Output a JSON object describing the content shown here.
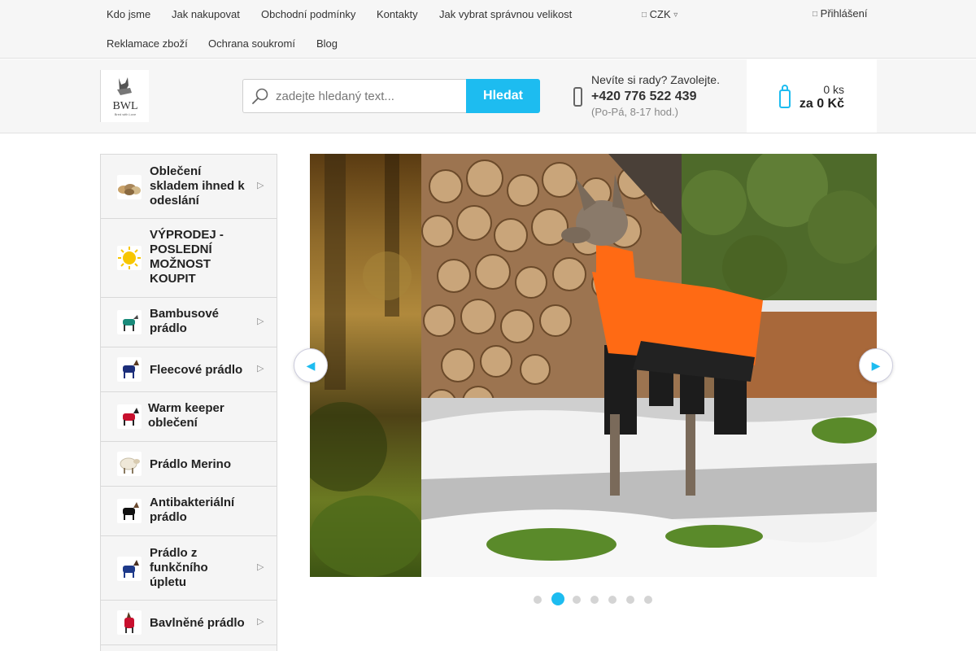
{
  "topnav": {
    "links": [
      "Kdo jsme",
      "Jak nakupovat",
      "Obchodní podmínky",
      "Kontakty",
      "Jak vybrat správnou velikost",
      "Reklamace zboží",
      "Ochrana soukromí",
      "Blog"
    ],
    "currency": "CZK",
    "login": "Přihlášení"
  },
  "header": {
    "logo_text": "BWL",
    "logo_sub": "Bred with Love",
    "search": {
      "placeholder": "zadejte hledaný text...",
      "button": "Hledat"
    },
    "contact": {
      "question": "Nevíte si rady? Zavolejte.",
      "phone": "+420 776 522 439",
      "hours": "(Po-Pá, 8-17 hod.)"
    },
    "cart": {
      "count": "0 ks",
      "total": "za 0 Kč"
    }
  },
  "sidebar": {
    "categories": [
      {
        "lines": [
          "Oblečení",
          "skladem ihned k",
          "odeslání"
        ],
        "has_submenu": true,
        "thumb": "clothes-pile"
      },
      {
        "lines": [
          "VÝPRODEJ -",
          "POSLEDNÍ",
          "MOŽNOST",
          "KOUPIT"
        ],
        "has_submenu": false,
        "thumb": "sun"
      },
      {
        "lines": [
          "Bambusové",
          "prádlo"
        ],
        "has_submenu": true,
        "thumb": "dog-green"
      },
      {
        "lines": [
          "Fleecové prádlo"
        ],
        "has_submenu": true,
        "thumb": "dog-navy"
      },
      {
        "lines": [
          "Warm keeper",
          "oblečení"
        ],
        "has_submenu": false,
        "thumb": "dog-red"
      },
      {
        "lines": [
          "Prádlo Merino"
        ],
        "has_submenu": false,
        "thumb": "sheep"
      },
      {
        "lines": [
          "Antibakteriální",
          "prádlo"
        ],
        "has_submenu": false,
        "thumb": "dog-black"
      },
      {
        "lines": [
          "Prádlo z",
          "funkčního",
          "úpletu"
        ],
        "has_submenu": true,
        "thumb": "dog-blue"
      },
      {
        "lines": [
          "Bavlněné prádlo"
        ],
        "has_submenu": true,
        "thumb": "dog-red-2"
      }
    ]
  },
  "slider": {
    "slide_count": 7,
    "active_index": 1
  },
  "colors": {
    "accent": "#1dbcf0",
    "jacket": "#ff6a14"
  }
}
